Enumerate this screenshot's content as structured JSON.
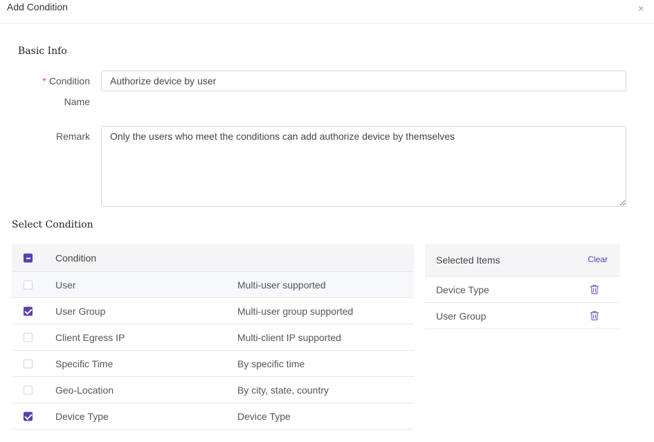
{
  "dialog": {
    "title": "Add Condition",
    "close_glyph": "×"
  },
  "basic_info": {
    "title": "Basic Info",
    "condition_name_label_line1": "Condition",
    "condition_name_label_line2": "Name",
    "required_mark": "*",
    "condition_name_value": "Authorize device by user",
    "remark_label": "Remark",
    "remark_value": "Only the users who meet the conditions can add authorize device by themselves"
  },
  "select_condition": {
    "title": "Select Condition",
    "header": {
      "label": "Condition",
      "check_state": "partial"
    },
    "rows": [
      {
        "name": "User",
        "desc": "Multi-user supported",
        "checked": false
      },
      {
        "name": "User Group",
        "desc": "Multi-user group supported",
        "checked": true
      },
      {
        "name": "Client Egress IP",
        "desc": "Multi-client IP supported",
        "checked": false
      },
      {
        "name": "Specific Time",
        "desc": "By specific time",
        "checked": false
      },
      {
        "name": "Geo-Location",
        "desc": "By city, state, country",
        "checked": false
      },
      {
        "name": "Device Type",
        "desc": "Device Type",
        "checked": true
      }
    ]
  },
  "selected_items": {
    "title": "Selected Items",
    "clear_label": "Clear",
    "items": [
      {
        "name": "Device Type"
      },
      {
        "name": "User Group"
      }
    ]
  },
  "colors": {
    "accent": "#5b3fb0",
    "required": "#e8482f",
    "header_bg": "#f5f5f7"
  }
}
